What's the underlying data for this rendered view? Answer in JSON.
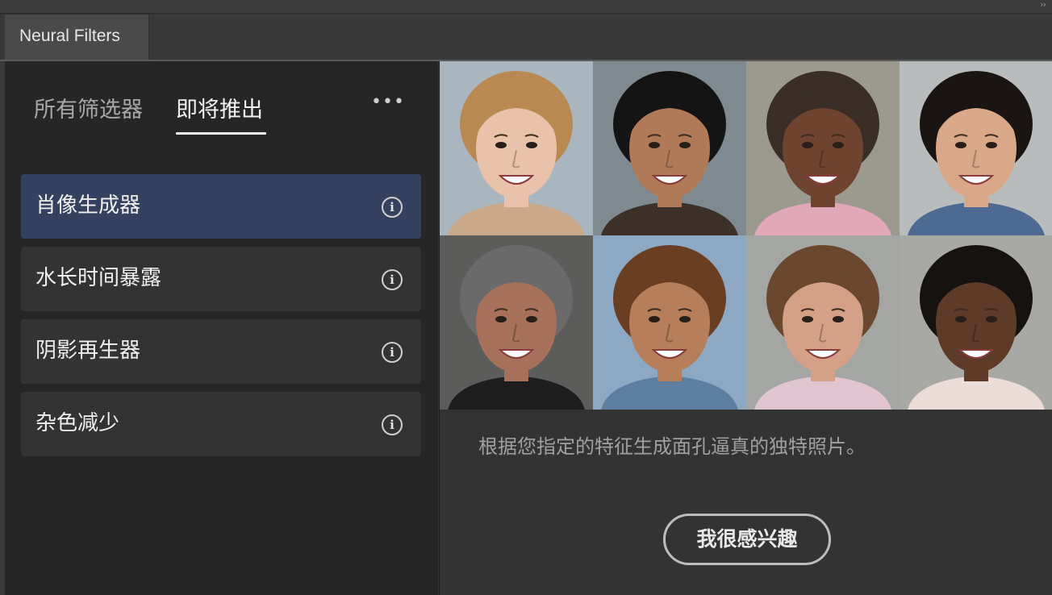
{
  "window": {
    "collapse_icon": "double-chevron-right-icon",
    "collapse_glyph": "››"
  },
  "panel": {
    "tab_label": "Neural Filters"
  },
  "filter_tabs": {
    "all": "所有筛选器",
    "coming_soon": "即将推出",
    "more_glyph": "•••"
  },
  "filters": [
    {
      "label": "肖像生成器",
      "selected": true
    },
    {
      "label": "水长时间暴露",
      "selected": false
    },
    {
      "label": "阴影再生器",
      "selected": false
    },
    {
      "label": "杂色减少",
      "selected": false
    }
  ],
  "info_glyph": "i",
  "preview": {
    "description": "根据您指定的特征生成面孔逼真的独特照片。",
    "button_label": "我很感兴趣",
    "faces": [
      {
        "bg": "#aab6bf",
        "skin": "#e8c2aa",
        "hair": "#b88a52",
        "shirt": "#c9a98a"
      },
      {
        "bg": "#7e8a90",
        "skin": "#b07a58",
        "hair": "#141414",
        "shirt": "#3c3028"
      },
      {
        "bg": "#9c9a8e",
        "skin": "#6e4430",
        "hair": "#3a2e26",
        "shirt": "#e0a8b8"
      },
      {
        "bg": "#b9bcbc",
        "skin": "#d8a888",
        "hair": "#1a1412",
        "shirt": "#4e6a92"
      },
      {
        "bg": "#5c5c5a",
        "skin": "#a6705a",
        "hair": "#6a6a6a",
        "shirt": "#1e1e1e"
      },
      {
        "bg": "#8ca8c2",
        "skin": "#b67e5a",
        "hair": "#6a3e22",
        "shirt": "#5e7ea0"
      },
      {
        "bg": "#a4a6a4",
        "skin": "#d4a088",
        "hair": "#6a4830",
        "shirt": "#e0c4d0"
      },
      {
        "bg": "#a8a8a4",
        "skin": "#5e3a28",
        "hair": "#161210",
        "shirt": "#ecdcd8"
      }
    ]
  }
}
